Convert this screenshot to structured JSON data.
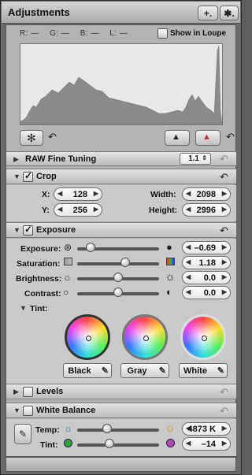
{
  "title": "Adjustments",
  "toolbar": {
    "add_label": "+.",
    "gear_label": "✱."
  },
  "readout": {
    "r": "R: —",
    "g": "G: —",
    "b": "B: —",
    "l": "L: —"
  },
  "show_in_loupe": "Show in Loupe",
  "raw_fine_tuning": {
    "label": "RAW Fine Tuning",
    "version": "1.1"
  },
  "crop": {
    "label": "Crop",
    "x_label": "X:",
    "x": "128",
    "y_label": "Y:",
    "y": "256",
    "width_label": "Width:",
    "width": "2098",
    "height_label": "Height:",
    "height": "2996"
  },
  "exposure": {
    "label": "Exposure",
    "rows": [
      {
        "label": "Exposure:",
        "value": "–0.69",
        "level": 0.12
      },
      {
        "label": "Saturation:",
        "value": "1.18",
        "level": 0.6
      },
      {
        "label": "Brightness:",
        "value": "0.0",
        "level": 0.5
      },
      {
        "label": "Contrast:",
        "value": "0.0",
        "level": 0.5
      }
    ],
    "tint_label": "Tint:",
    "wheels": [
      {
        "label": "Black"
      },
      {
        "label": "Gray"
      },
      {
        "label": "White"
      }
    ]
  },
  "levels": {
    "label": "Levels"
  },
  "white_balance": {
    "label": "White Balance",
    "temp_label": "Temp:",
    "temp": "4873 K",
    "temp_level": 0.35,
    "tint_label": "Tint:",
    "tint": "–14",
    "tint_level": 0.38
  },
  "colors": {
    "panel": "#6a6a6a",
    "section_bg": "#c9c9c9",
    "header": "#d0d0d0"
  }
}
